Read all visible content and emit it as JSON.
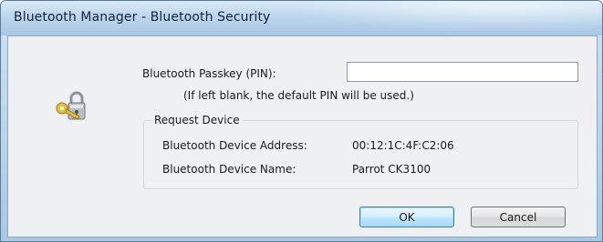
{
  "window": {
    "title": "Bluetooth Manager - Bluetooth Security"
  },
  "dialog": {
    "icon": "lock-with-key-icon",
    "passkey_label": "Bluetooth Passkey (PIN):",
    "passkey_value": "",
    "passkey_placeholder": "",
    "hint": "(If left blank, the default PIN will be used.)",
    "request_device": {
      "title": "Request Device",
      "address_label": "Bluetooth Device Address:",
      "address_value": "00:12:1C:4F:C2:06",
      "name_label": "Bluetooth Device Name:",
      "name_value": "Parrot CK3100"
    },
    "buttons": {
      "ok": "OK",
      "cancel": "Cancel"
    }
  },
  "colors": {
    "titlebar": "#bcd6ec",
    "client_background": "#eef0f2",
    "default_button_border": "#3c7fb1"
  }
}
